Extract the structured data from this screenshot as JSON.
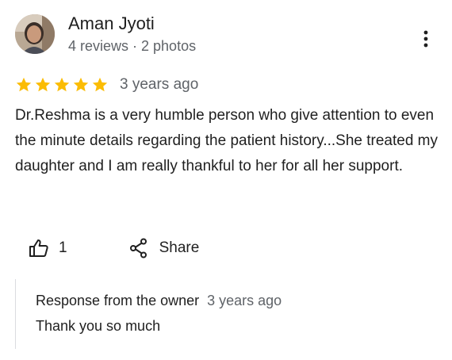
{
  "author": {
    "name": "Aman Jyoti",
    "meta": "4 reviews · 2 photos"
  },
  "review": {
    "rating": 5,
    "rating_max": 5,
    "date": "3 years ago",
    "text": "Dr.Reshma is a very humble person who give attention to even the minute details regarding the patient history...She treated my daughter and I am really thankful to her for all her support."
  },
  "actions": {
    "like_count": "1",
    "share_label": "Share"
  },
  "owner_response": {
    "title": "Response from the owner",
    "date": "3 years ago",
    "text": "Thank you so much"
  },
  "icons": {
    "more": "more-vert-icon",
    "star": "star-icon",
    "like": "thumb-up-icon",
    "share": "share-icon"
  },
  "colors": {
    "star": "#fbbc04",
    "text_primary": "#1f1f1f",
    "text_secondary": "#5f6368",
    "divider": "#dadce0"
  }
}
